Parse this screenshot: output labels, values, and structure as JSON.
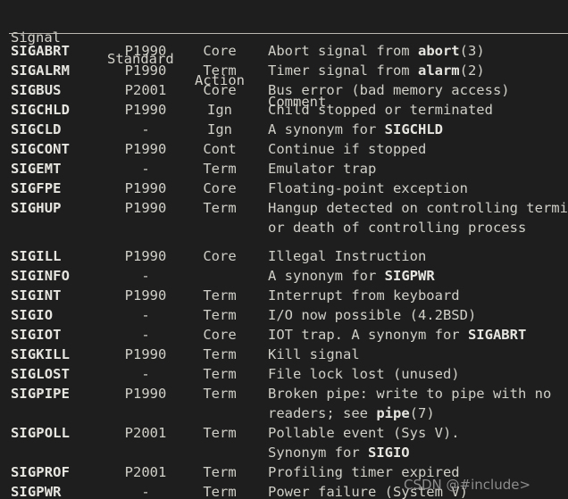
{
  "document": {
    "type": "man-page-signal-table",
    "background_color": "#1e1e1e",
    "text_color": "#d0cfc8",
    "bold_color": "#e6e5e0",
    "rule_color": "#b9b7b0"
  },
  "table": {
    "headers": {
      "signal": "Signal",
      "standard": "Standard",
      "action": "Action",
      "comment": "Comment"
    },
    "rows": [
      {
        "signal": "SIGABRT",
        "standard": "P1990",
        "action": "Core",
        "comment_parts": [
          {
            "text": "Abort signal from ",
            "bold": false
          },
          {
            "text": "abort",
            "bold": true
          },
          {
            "text": "(3)",
            "bold": false
          }
        ]
      },
      {
        "signal": "SIGALRM",
        "standard": "P1990",
        "action": "Term",
        "comment_parts": [
          {
            "text": "Timer signal from ",
            "bold": false
          },
          {
            "text": "alarm",
            "bold": true
          },
          {
            "text": "(2)",
            "bold": false
          }
        ]
      },
      {
        "signal": "SIGBUS",
        "standard": "P2001",
        "action": "Core",
        "comment_parts": [
          {
            "text": "Bus error (bad memory access)",
            "bold": false
          }
        ]
      },
      {
        "signal": "SIGCHLD",
        "standard": "P1990",
        "action": "Ign",
        "comment_parts": [
          {
            "text": "Child stopped or terminated",
            "bold": false
          }
        ]
      },
      {
        "signal": "SIGCLD",
        "standard": "-",
        "action": "Ign",
        "comment_parts": [
          {
            "text": "A synonym for ",
            "bold": false
          },
          {
            "text": "SIGCHLD",
            "bold": true
          }
        ]
      },
      {
        "signal": "SIGCONT",
        "standard": "P1990",
        "action": "Cont",
        "comment_parts": [
          {
            "text": "Continue if stopped",
            "bold": false
          }
        ]
      },
      {
        "signal": "SIGEMT",
        "standard": "-",
        "action": "Term",
        "comment_parts": [
          {
            "text": "Emulator trap",
            "bold": false
          }
        ]
      },
      {
        "signal": "SIGFPE",
        "standard": "P1990",
        "action": "Core",
        "comment_parts": [
          {
            "text": "Floating-point exception",
            "bold": false
          }
        ]
      },
      {
        "signal": "SIGHUP",
        "standard": "P1990",
        "action": "Term",
        "comment_parts": [
          {
            "text": "Hangup detected on controlling termina",
            "bold": false
          }
        ],
        "continuation": [
          {
            "text": "or death of controlling process",
            "bold": false
          }
        ],
        "blank_after": true
      },
      {
        "signal": "SIGILL",
        "standard": "P1990",
        "action": "Core",
        "comment_parts": [
          {
            "text": "Illegal Instruction",
            "bold": false
          }
        ]
      },
      {
        "signal": "SIGINFO",
        "standard": "-",
        "action": "",
        "comment_parts": [
          {
            "text": "A synonym for ",
            "bold": false
          },
          {
            "text": "SIGPWR",
            "bold": true
          }
        ]
      },
      {
        "signal": "SIGINT",
        "standard": "P1990",
        "action": "Term",
        "comment_parts": [
          {
            "text": "Interrupt from keyboard",
            "bold": false
          }
        ]
      },
      {
        "signal": "SIGIO",
        "standard": "-",
        "action": "Term",
        "comment_parts": [
          {
            "text": "I/O now possible (4.2BSD)",
            "bold": false
          }
        ]
      },
      {
        "signal": "SIGIOT",
        "standard": "-",
        "action": "Core",
        "comment_parts": [
          {
            "text": "IOT trap. A synonym for ",
            "bold": false
          },
          {
            "text": "SIGABRT",
            "bold": true
          }
        ]
      },
      {
        "signal": "SIGKILL",
        "standard": "P1990",
        "action": "Term",
        "comment_parts": [
          {
            "text": "Kill signal",
            "bold": false
          }
        ]
      },
      {
        "signal": "SIGLOST",
        "standard": "-",
        "action": "Term",
        "comment_parts": [
          {
            "text": "File lock lost (unused)",
            "bold": false
          }
        ]
      },
      {
        "signal": "SIGPIPE",
        "standard": "P1990",
        "action": "Term",
        "comment_parts": [
          {
            "text": "Broken pipe: write to pipe with no",
            "bold": false
          }
        ],
        "continuation": [
          {
            "text": "readers; see ",
            "bold": false
          },
          {
            "text": "pipe",
            "bold": true
          },
          {
            "text": "(7)",
            "bold": false
          }
        ]
      },
      {
        "signal": "SIGPOLL",
        "standard": "P2001",
        "action": "Term",
        "comment_parts": [
          {
            "text": "Pollable event (Sys V).",
            "bold": false
          }
        ],
        "continuation": [
          {
            "text": "Synonym for ",
            "bold": false
          },
          {
            "text": "SIGIO",
            "bold": true
          }
        ]
      },
      {
        "signal": "SIGPROF",
        "standard": "P2001",
        "action": "Term",
        "comment_parts": [
          {
            "text": "Profiling timer expired",
            "bold": false
          }
        ]
      },
      {
        "signal": "SIGPWR",
        "standard": "-",
        "action": "Term",
        "comment_parts": [
          {
            "text": "Power failure (System V)",
            "bold": false
          }
        ]
      }
    ]
  },
  "watermark": {
    "text": "CSDN @#include>"
  }
}
